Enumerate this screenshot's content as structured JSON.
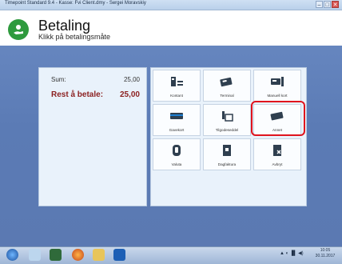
{
  "window": {
    "title": "Timepoint Standard 9.4 - Kasse: Fvi Client.dmy - Sergei Moravskiy",
    "minimize": "–",
    "maximize": "□",
    "close": "✕"
  },
  "header": {
    "title": "Betaling",
    "subtitle": "Klikk på betalingsmåte",
    "logo_icon": "payment-hand-icon",
    "brand_color": "#2e9a3d"
  },
  "summary": {
    "sum_label": "Sum:",
    "sum_value": "25,00",
    "rest_label": "Rest å betale:",
    "rest_value": "25,00",
    "rest_color": "#8b1f1f"
  },
  "payment_methods": [
    {
      "label": "Kontant",
      "icon": "cash-register-icon"
    },
    {
      "label": "Terminal",
      "icon": "card-terminal-icon"
    },
    {
      "label": "Manuell kort",
      "icon": "manual-card-icon"
    },
    {
      "label": "Gavekort",
      "icon": "gift-card-icon"
    },
    {
      "label": "Tilgodeseddel",
      "icon": "voucher-icon"
    },
    {
      "label": "Annet",
      "icon": "other-card-icon"
    },
    {
      "label": "Valuta",
      "icon": "currency-icon"
    },
    {
      "label": "Dagfaktura",
      "icon": "invoice-icon"
    },
    {
      "label": "Avbryt",
      "icon": "cancel-document-icon"
    }
  ],
  "highlight_color": "#e0141e",
  "taskbar": {
    "tray_text": "▲ ◐ ▐▌ ◀)",
    "time": "10:05",
    "date": "30.11.2017"
  }
}
